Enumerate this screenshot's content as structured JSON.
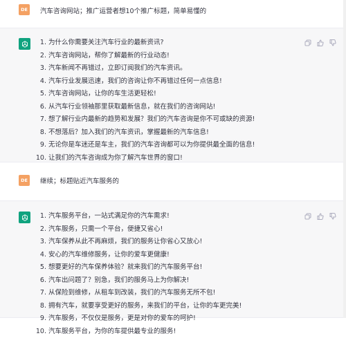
{
  "conversation": [
    {
      "role": "user",
      "avatar_label": "DE",
      "text": "汽车咨询网站；推广运营者想10个推广标题，简单易懂的"
    },
    {
      "role": "assistant",
      "icon": "chatgpt-logo-icon",
      "items": [
        "为什么你需要关注汽车行业的最新资讯?",
        "汽车咨询网站，帮你了解最新的行业动态!",
        "汽车新闻不再错过，立即订阅我们的汽车资讯。",
        "汽车行业发展迅速，我们的咨询让你不再错过任何一点信息!",
        "汽车咨询网站，让你的车生活更轻松!",
        "从汽车行业领袖那里获取最新信息，就在我们的咨询网站!",
        "想了解行业内最新的趋势和发展？我们的汽车咨询是你不可或缺的资源!",
        "不想落后？加入我们的汽车资讯，掌握最新的汽车信息!",
        "无论你是车迷还是车主，我们的汽车咨询都可以为你提供最全面的信息!",
        "让我们的汽车咨询成为你了解汽车世界的窗口!"
      ]
    },
    {
      "role": "user",
      "avatar_label": "DE",
      "text": "继续；标题贴近汽车服务的"
    },
    {
      "role": "assistant",
      "icon": "chatgpt-logo-icon",
      "items": [
        "汽车服务平台，一站式满足你的汽车需求!",
        "汽车服务，只需一个平台，便捷又省心!",
        "汽车保养从此不再麻烦，我们的服务让你省心又放心!",
        "安心的汽车维修服务，让你的爱车更健康!",
        "想要更好的汽车保养体验？就来我们的汽车服务平台!",
        "汽车出问题了？别急，我们的服务马上为你解决!",
        "从保险到维修，从租车到改装，我们的汽车服务无所不包!",
        "拥有汽车，就要享受更好的服务，来我们的平台，让你的车更完美!",
        "汽车服务，不仅仅是服务，更是对你的爱车的呵护!",
        "汽车服务平台，为你的车提供最专业的服务!"
      ]
    }
  ],
  "actions": [
    "copy-icon",
    "thumbs-up-icon",
    "thumbs-down-icon"
  ],
  "colors": {
    "user_avatar": "#f4a163",
    "bot_avatar": "#10a37f",
    "assistant_bg": "#f7f7f8"
  }
}
